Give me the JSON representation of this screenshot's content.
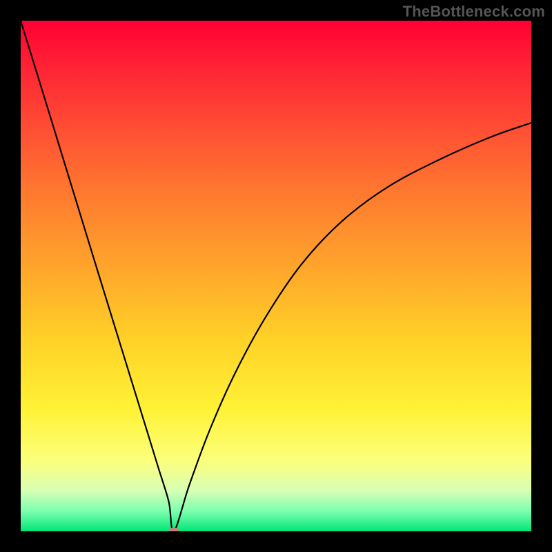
{
  "watermark": "TheBottleneck.com",
  "chart_data": {
    "type": "line",
    "title": "",
    "xlabel": "",
    "ylabel": "",
    "xlim": [
      0,
      100
    ],
    "ylim": [
      0,
      100
    ],
    "grid": false,
    "legend": false,
    "series": [
      {
        "name": "bottleneck-curve",
        "x": [
          0,
          5,
          10,
          15,
          20,
          25,
          27,
          29,
          30,
          33,
          37,
          42,
          48,
          55,
          63,
          72,
          82,
          92,
          100
        ],
        "y": [
          100,
          83.8,
          67.5,
          51.2,
          35,
          18.8,
          12.3,
          5.8,
          0,
          9,
          19.8,
          31,
          42,
          52.3,
          60.8,
          67.5,
          72.8,
          77.2,
          80
        ]
      }
    ],
    "marker": {
      "x": 30,
      "y": 0
    },
    "gradient_stops": [
      {
        "pos": 0,
        "color": "#ff0033"
      },
      {
        "pos": 8,
        "color": "#ff1f35"
      },
      {
        "pos": 20,
        "color": "#ff4a34"
      },
      {
        "pos": 34,
        "color": "#ff7a2f"
      },
      {
        "pos": 48,
        "color": "#ffa42b"
      },
      {
        "pos": 62,
        "color": "#ffd027"
      },
      {
        "pos": 76,
        "color": "#fff235"
      },
      {
        "pos": 86,
        "color": "#fcff7a"
      },
      {
        "pos": 92,
        "color": "#d8ffb4"
      },
      {
        "pos": 96,
        "color": "#7dffb0"
      },
      {
        "pos": 100,
        "color": "#00e676"
      }
    ]
  }
}
